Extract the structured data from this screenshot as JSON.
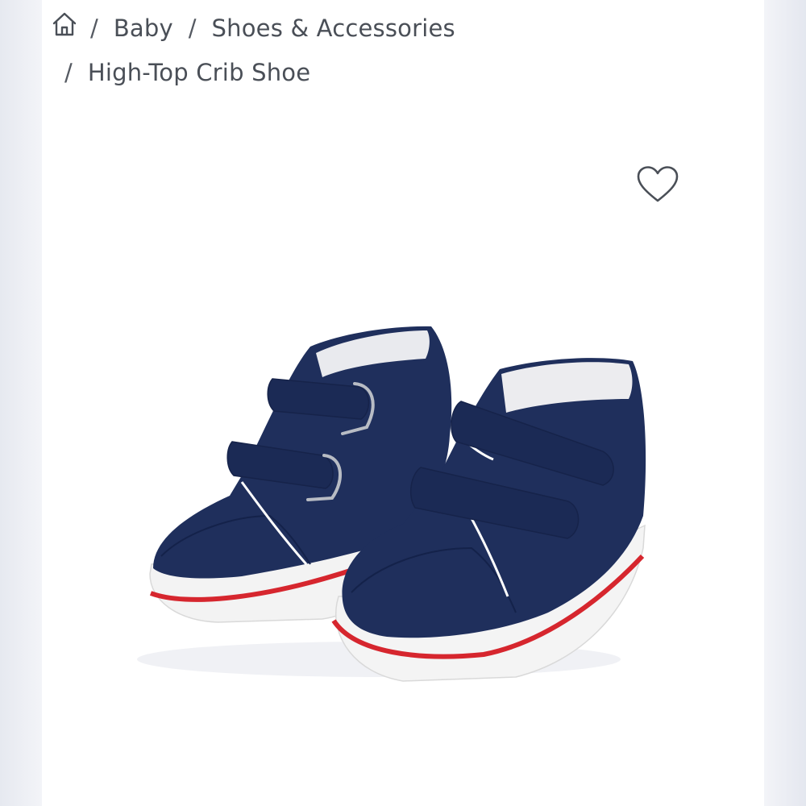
{
  "breadcrumb": {
    "home_icon": "home-icon",
    "separator": "/",
    "items": [
      "Baby",
      "Shoes & Accessories",
      "High-Top Crib Shoe"
    ]
  },
  "favorite": {
    "icon": "heart-outline-icon"
  },
  "product_image": {
    "subject": "navy high-top crib shoes with hook-and-loop straps"
  },
  "colors": {
    "shoe_navy": "#1f2f5c",
    "sole_white": "#f4f4f4",
    "sole_stripe": "#d6262e",
    "text": "#4a4f57"
  }
}
